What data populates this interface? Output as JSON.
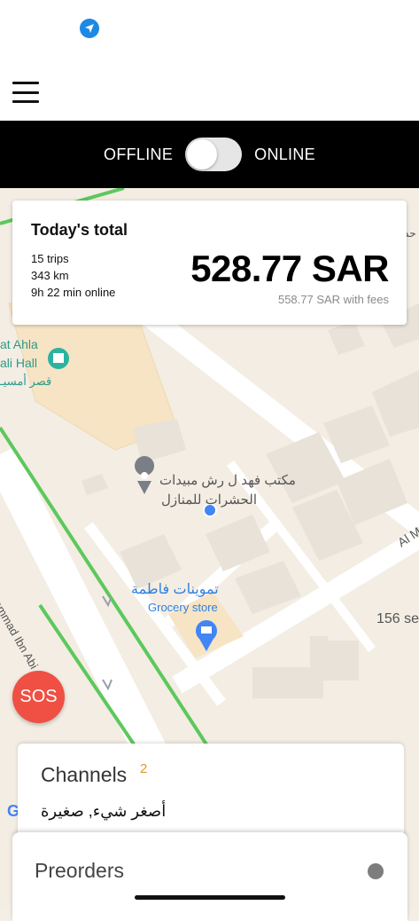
{
  "status": {
    "location_icon": "location-arrow-icon"
  },
  "topbar": {
    "menu_icon": "hamburger-menu-icon"
  },
  "availability": {
    "offline_label": "OFFLINE",
    "online_label": "ONLINE",
    "is_online": false
  },
  "summary": {
    "title": "Today's total",
    "trips": "15 trips",
    "distance": "343 km",
    "online_time": "9h 22 min online",
    "amount": "528.77 SAR",
    "amount_with_fees": "558.77 SAR with fees"
  },
  "map": {
    "labels": {
      "hall_line1": "at Ahla",
      "hall_line2": "ali Hall",
      "hall_line3": "قصر أمسيـ",
      "pest_line1": "مكتب فهد ل رش مبيدات",
      "pest_line2": "الحشرات للمنازل",
      "grocery_arabic": "تموينات فاطمة",
      "grocery_type": "Grocery store",
      "street_left": "Muhammad Ibn Abi Ali",
      "street_right": "Al M",
      "street_right2": "156 se",
      "corner_top": "حد",
      "google_g": "G"
    },
    "colors": {
      "road_green": "#5cc85c",
      "block": "#e8e2d8",
      "park": "#f6e4c4"
    }
  },
  "sos": {
    "label": "SOS",
    "color": "#ef5043"
  },
  "channels": {
    "title": "Channels",
    "count": "2",
    "last_message": "أصغر شيء, صغيرة"
  },
  "preorders": {
    "title": "Preorders"
  }
}
